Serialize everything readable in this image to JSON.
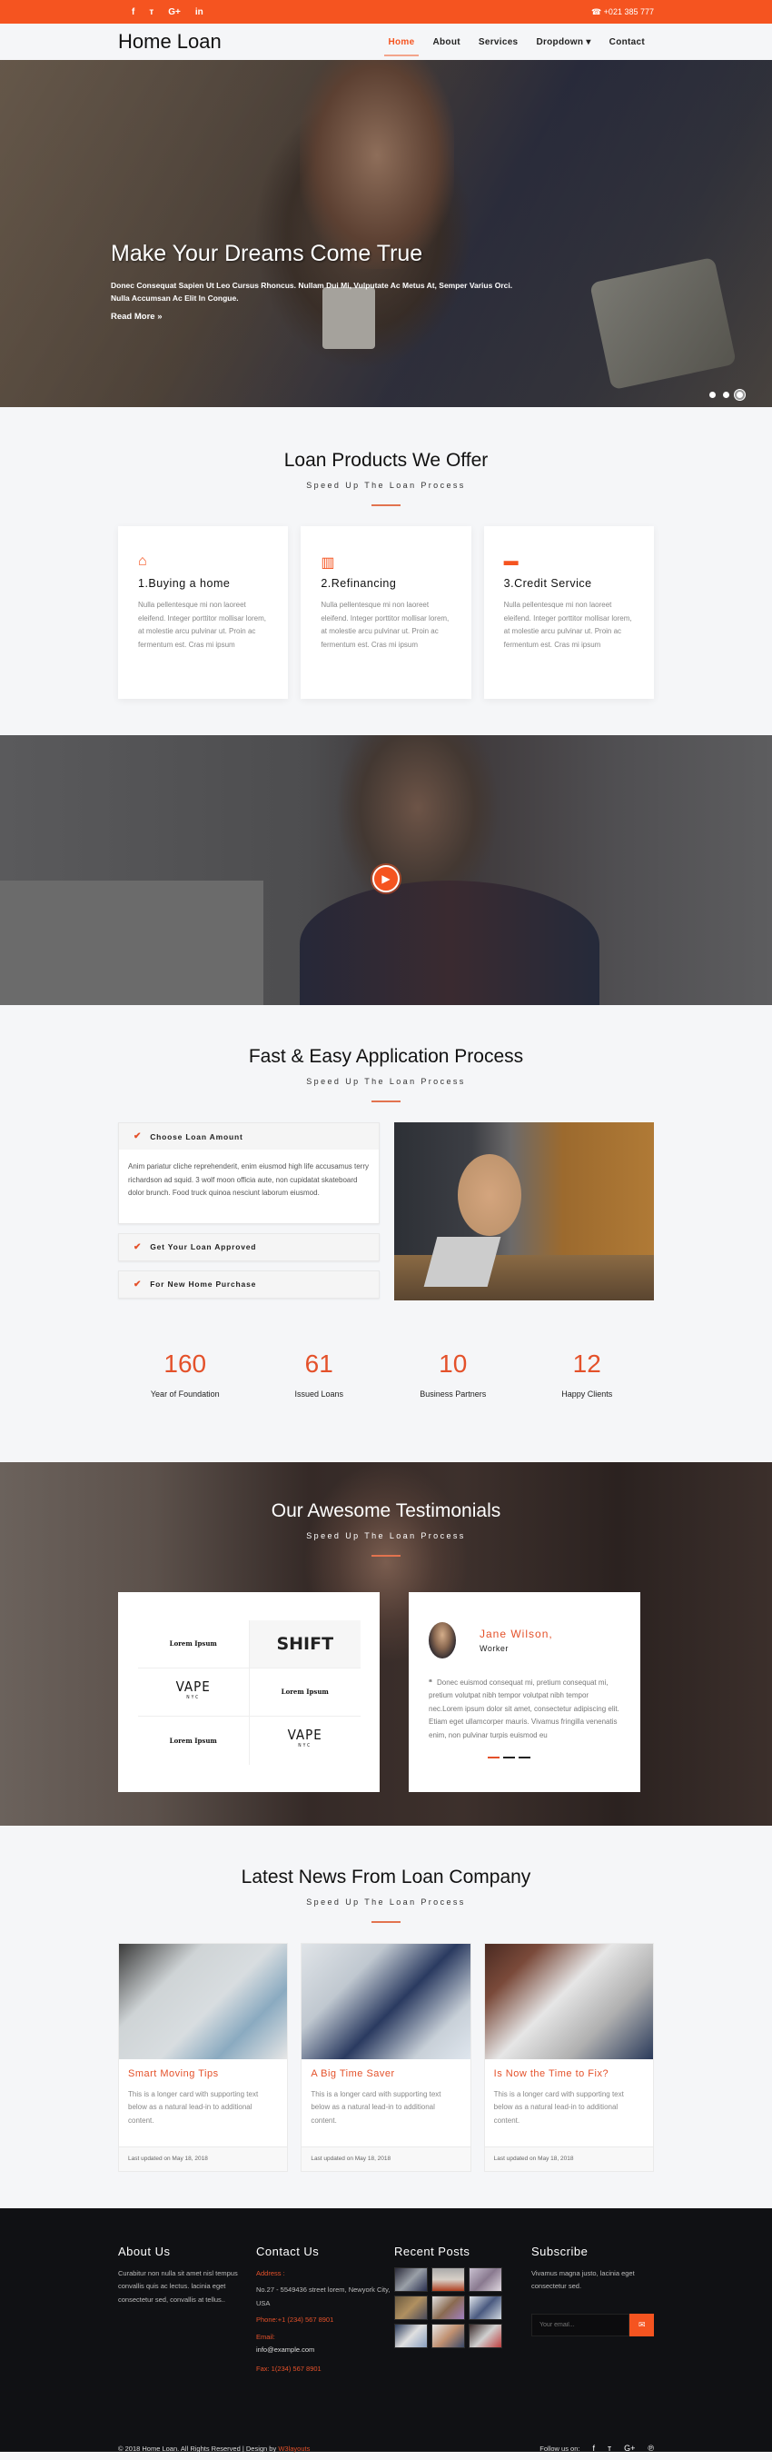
{
  "topbar": {
    "social": [
      {
        "icon": "facebook-icon",
        "glyph": "f"
      },
      {
        "icon": "twitter-icon",
        "glyph": "ᴛ"
      },
      {
        "icon": "google-plus-icon",
        "glyph": "G+"
      },
      {
        "icon": "linkedin-icon",
        "glyph": "in"
      }
    ],
    "phone": "☎ +021 385 777"
  },
  "nav": {
    "brand": "Home Loan",
    "items": [
      {
        "label": "Home",
        "active": true
      },
      {
        "label": "About"
      },
      {
        "label": "Services"
      },
      {
        "label": "Dropdown ▾"
      },
      {
        "label": "Contact"
      }
    ]
  },
  "hero": {
    "title": "Make Your Dreams Come True",
    "text": "Donec Consequat Sapien Ut Leo Cursus Rhoncus. Nullam Dui Mi, Vulputate Ac Metus At, Semper Varius Orci. Nulla Accumsan Ac Elit In Congue.",
    "read_more": "Read More »",
    "slides": 3,
    "active_slide": 3
  },
  "products": {
    "title": "Loan Products We Offer",
    "subtitle": "Speed Up The Loan Process",
    "cards": [
      {
        "icon": "home-icon",
        "glyph": "⌂",
        "title": "1.Buying a home",
        "text": "Nulla pellentesque mi non laoreet eleifend. Integer porttitor mollisar lorem, at molestie arcu pulvinar ut. Proin ac fermentum est. Cras mi ipsum"
      },
      {
        "icon": "building-icon",
        "glyph": "▥",
        "title": "2.Refinancing",
        "text": "Nulla pellentesque mi non laoreet eleifend. Integer porttitor mollisar lorem, at molestie arcu pulvinar ut. Proin ac fermentum est. Cras mi ipsum"
      },
      {
        "icon": "credit-card-icon",
        "glyph": "▬",
        "title": "3.Credit Service",
        "text": "Nulla pellentesque mi non laoreet eleifend. Integer porttitor mollisar lorem, at molestie arcu pulvinar ut. Proin ac fermentum est. Cras mi ipsum"
      }
    ]
  },
  "video": {
    "play_glyph": "▶"
  },
  "process": {
    "title": "Fast & Easy Application Process",
    "subtitle": "Speed Up The Loan Process",
    "items": [
      {
        "label": "Choose Loan Amount",
        "open": true,
        "body": "Anim pariatur cliche reprehenderit, enim eiusmod high life accusamus terry richardson ad squid. 3 wolf moon officia aute, non cupidatat skateboard dolor brunch. Food truck quinoa nesciunt laborum eiusmod."
      },
      {
        "label": "Get Your Loan Approved"
      },
      {
        "label": "For New Home Purchase"
      }
    ],
    "check_glyph": "✔"
  },
  "stats": [
    {
      "value": "160",
      "label": "Year of Foundation"
    },
    {
      "value": "61",
      "label": "Issued Loans"
    },
    {
      "value": "10",
      "label": "Business Partners"
    },
    {
      "value": "12",
      "label": "Happy Clients"
    }
  ],
  "testimonials": {
    "title": "Our Awesome Testimonials",
    "subtitle": "Speed Up The Loan Process",
    "logos": [
      "Lorem Ipsum",
      "SHIFT",
      "VAPE",
      "Lorem Ipsum",
      "Lorem Ipsum",
      "VAPE"
    ],
    "logo_sub": "NYC",
    "name": "Jane Wilson,",
    "role": "Worker",
    "quote_mark": "“",
    "quote": "Donec euismod consequat mi, pretium consequat mi, pretium volutpat nibh tempor volutpat nibh tempor nec.Lorem ipsum dolor sit amet, consectetur adipiscing elit. Etiam eget ullamcorper mauris. Vivamus fringilla venenatis enim, non pulvinar turpis euismod eu",
    "slides": 3,
    "active_slide": 1
  },
  "news": {
    "title": "Latest News From Loan Company",
    "subtitle": "Speed Up The Loan Process",
    "cards": [
      {
        "title": "Smart Moving Tips",
        "text": "This is a longer card with supporting text below as a natural lead-in to additional content.",
        "updated": "Last updated on May 18, 2018"
      },
      {
        "title": "A Big Time Saver",
        "text": "This is a longer card with supporting text below as a natural lead-in to additional content.",
        "updated": "Last updated on May 18, 2018"
      },
      {
        "title": "Is Now the Time to Fix?",
        "text": "This is a longer card with supporting text below as a natural lead-in to additional content.",
        "updated": "Last updated on May 18, 2018"
      }
    ]
  },
  "footer": {
    "about": {
      "title": "About Us",
      "text": "Curabitur non nulla sit amet nisl tempus convallis quis ac lectus. lacinia eget consectetur sed, convallis at tellus.."
    },
    "contact": {
      "title": "Contact Us",
      "address_label": "Address :",
      "address": "No.27 - 5549436 street lorem, Newyork City, USA",
      "phone": "Phone:+1 (234) 567 8901",
      "email_label": "Email:",
      "email": "info@example.com",
      "fax": "Fax: 1(234) 567 8901"
    },
    "recent": {
      "title": "Recent Posts",
      "count": 9
    },
    "subscribe": {
      "title": "Subscribe",
      "text": "Vivamus magna justo, lacinia eget consectetur sed.",
      "placeholder": "Your email...",
      "button_glyph": "✉"
    },
    "copyright": "© 2018 Home Loan. All Rights Reserved | Design by ",
    "designer": "W3layouts",
    "follow": "Follow us on:",
    "follow_icons": [
      {
        "icon": "facebook-icon",
        "glyph": "f"
      },
      {
        "icon": "twitter-icon",
        "glyph": "ᴛ"
      },
      {
        "icon": "google-plus-icon",
        "glyph": "G+"
      },
      {
        "icon": "pinterest-icon",
        "glyph": "℗"
      }
    ]
  }
}
